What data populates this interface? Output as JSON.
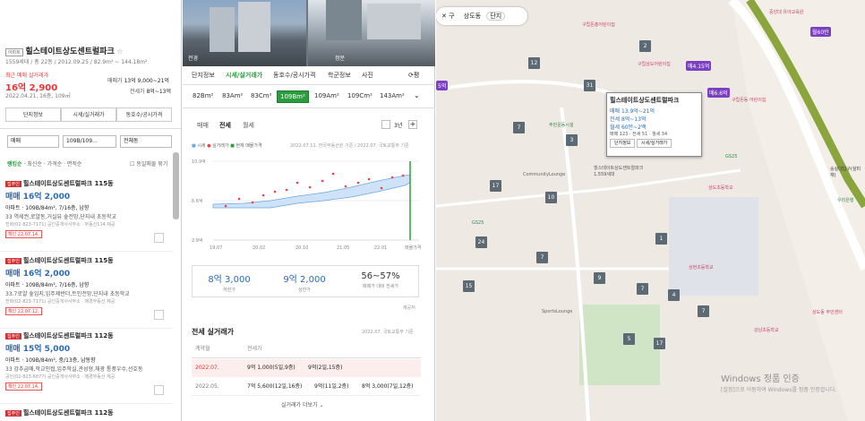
{
  "left": {
    "tag": "아파트",
    "title": "힐스테이트상도센트럴파크",
    "meta": "1559세대 / 총 22동 / 2012.09.25 / 82.9m² ~ 144.18m²",
    "recent_label": "최근 매매 실거래가",
    "recent_price": "16억 2,900",
    "recent_date": "2022.04.21, 16층, 109㎡",
    "sale_label": "매매가",
    "sale_range": "13억 9,000~21억",
    "jeonse_label": "전세가",
    "jeonse_range": "8억~13억",
    "buttons": [
      "단지정보",
      "시세/실거래가",
      "동호수/공시가격"
    ],
    "filters": [
      "매매",
      "109B/109...",
      "전체동"
    ],
    "sort_tabs": [
      "랭킹순",
      "최신순",
      "가격순",
      "면적순"
    ],
    "same_merge": "동일매물 묶기",
    "listings": [
      {
        "badge": "집주인",
        "name": "힐스테이트상도센트럴파크 115동",
        "price": "매매 16억 2,000",
        "type": "아파트 · 109B/84m², 7/16층, 남향",
        "desc": "33 역세권,로얄동,거실뷰 숲전망,단지내 초등학교",
        "agent": "전화(02-823-7171) 공인중개사사무소 · 부동산114 제공",
        "confirm": "확인 22.07.14."
      },
      {
        "badge": "집주인",
        "name": "힐스테이트상도센트럴파크 115동",
        "price": "매매 16억 2,000",
        "type": "아파트 · 109B/84m², 7/16층, 남향",
        "desc": "33.7로얄 숲입지,입주제반더,트인전망,단지내 초등학교",
        "agent": "전화(02-823-7171) 공인중개사사무소 · 매경부동산 제공",
        "confirm": "확인 22.07.12."
      },
      {
        "badge": "집주인",
        "name": "힐스테이트상도센트럴파크 112동",
        "price": "매매 15억 5,000",
        "type": "아파트 · 109B/84m², 중/13층, 남동향",
        "desc": "33 강추급매,학교인접,입주학실,관성형,채광 통풍우수,선호동",
        "agent": "공인(02-823-6877) 공인중개사사무소 · 매경부동산 제공",
        "confirm": "확인 22.07.14."
      },
      {
        "badge": "집주인",
        "name": "힐스테이트상도센트럴파크 112동",
        "price": "",
        "type": "",
        "desc": "",
        "agent": "",
        "confirm": ""
      }
    ]
  },
  "photos": {
    "labels": [
      "전경",
      "정문"
    ]
  },
  "mid": {
    "tabs": [
      "단지정보",
      "시세/실거래가",
      "동호수/공시가격",
      "학군정보",
      "사진"
    ],
    "eval": "평",
    "areas": [
      "82Bm²",
      "83Am²",
      "83Cm²",
      "109Bm²",
      "109Am²",
      "109Cm²",
      "143Am²"
    ],
    "deal_tabs": [
      "매매",
      "전세",
      "월세"
    ],
    "period": "3년",
    "legend": [
      "시세",
      "실거래가",
      "현재 매물가격"
    ],
    "source": "2022.07.11. 한국부동산원 기준 / 2022.07. 국토교통부 기준",
    "y_ticks": [
      "10.9억",
      "6.6억",
      "2.9억"
    ],
    "x_ticks": [
      "19.07",
      "20.02",
      "20.10",
      "21.05",
      "22.01",
      "매물가격"
    ],
    "stats": [
      {
        "value": "8억 3,000",
        "label": "하한가"
      },
      {
        "value": "9억 2,000",
        "label": "상한가"
      },
      {
        "value": "56~57%",
        "label": "매매가 대비 전세가"
      }
    ],
    "stats_source": "제공처",
    "trade_title": "전세 실거래가",
    "trade_source": "2022.07. 국토교통부 기준",
    "trade_headers": [
      "계약월",
      "전세가"
    ],
    "trade_rows": [
      {
        "month": "2022.07.",
        "items": [
          "9억 1,000(5일,9층)",
          "9억(2일,15층)"
        ]
      },
      {
        "month": "2022.05.",
        "items": [
          "7억 5,600(12일,16층)",
          "9억(11일,2층)",
          "8억 3,000(7일,12층)"
        ]
      }
    ],
    "more": "실거래가 더보기"
  },
  "map": {
    "search_tags": [
      "구",
      "상도동",
      "단지"
    ],
    "popup": {
      "title": "힐스테이트상도센트럴파크",
      "sale": "매매 13.9억~21억",
      "jeonse": "전세 8억~13억",
      "monthly": "월세 60만~2백",
      "counts": "매매 123 · 전세 51 · 월세 34",
      "btn1": "단지정보",
      "btn2": "시세/실거래가"
    },
    "price_markers": [
      "매4.15억",
      "매6.6억",
      "월60만",
      "5억"
    ],
    "markers": [
      "2",
      "12",
      "31",
      "7",
      "3",
      "17",
      "10",
      "24",
      "7",
      "9",
      "1",
      "4",
      "7",
      "5",
      "17",
      "15",
      "7"
    ],
    "pois": [
      "구립돈홍어린이집",
      "구립상도어린이집",
      "구립돈동 어린이집",
      "중앙대 유아교육원",
      "GS25",
      "주민운동시설",
      "CommunityLounge",
      "힐스테이트상도센트럴파크 1,559세대",
      "상도초등학교",
      "SportsLounge",
      "GS25",
      "숭실대입구(살피재)",
      "상현초등학교",
      "강남초등학교",
      "우리은행",
      "상도동 주민센터"
    ],
    "watermark": "Windows 정품 인증",
    "watermark_sub": "[설정]으로 이동하여 Windows를 정품 인증합니다."
  }
}
